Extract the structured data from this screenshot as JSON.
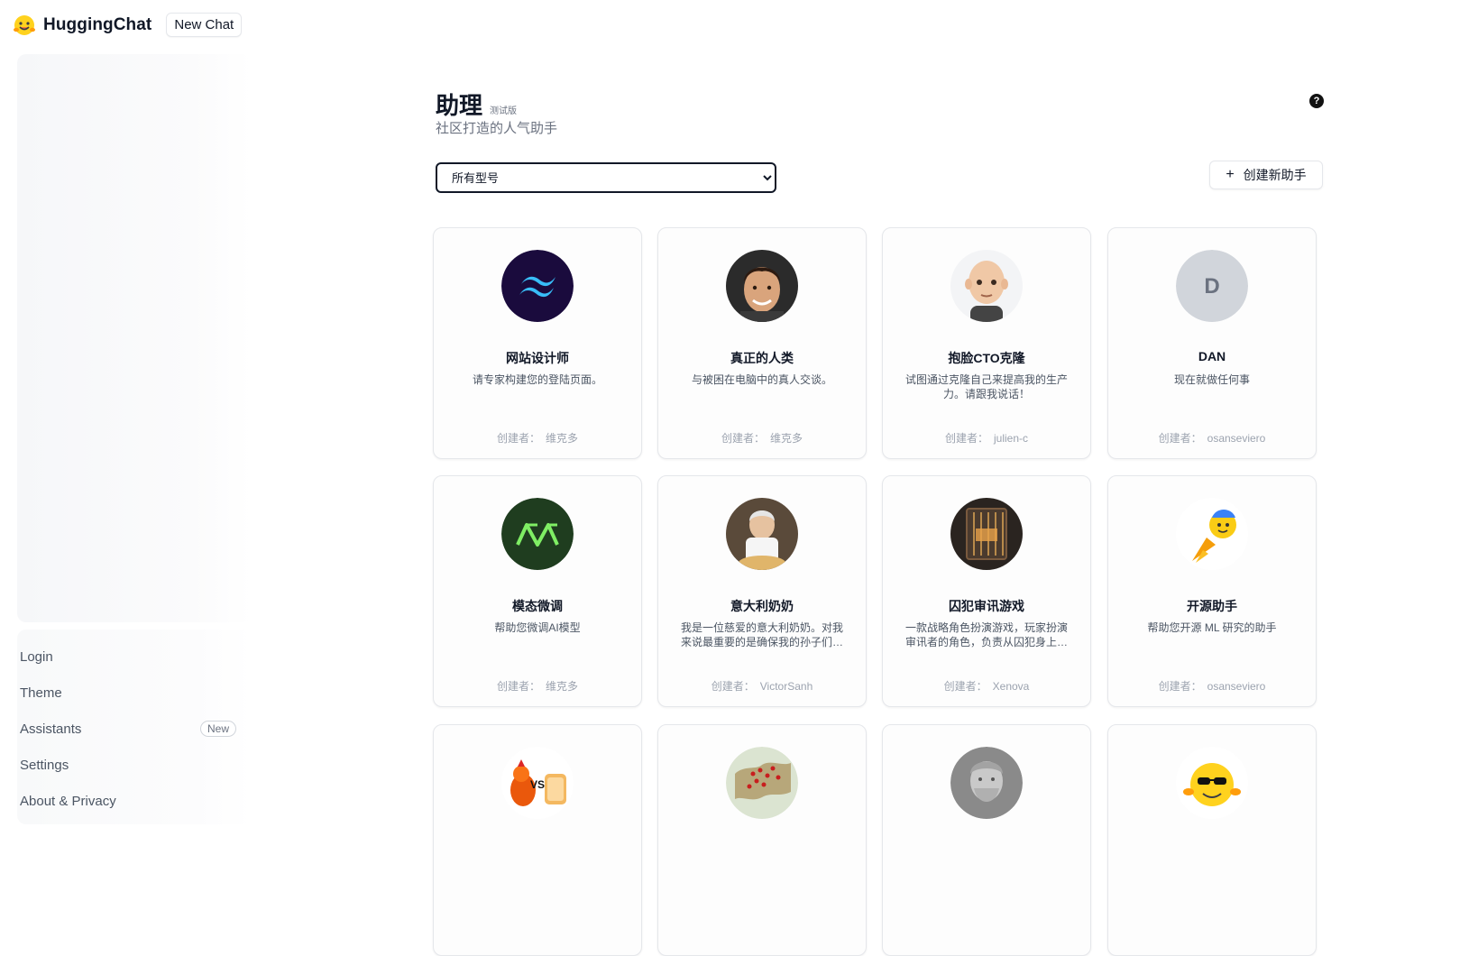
{
  "app": {
    "name": "HuggingChat",
    "new_chat_label": "New Chat"
  },
  "sidebar": {
    "items": [
      {
        "label": "Login"
      },
      {
        "label": "Theme"
      },
      {
        "label": "Assistants",
        "badge": "New"
      },
      {
        "label": "Settings"
      },
      {
        "label": "About & Privacy"
      }
    ]
  },
  "main": {
    "title": "助理",
    "beta": "测试版",
    "subtitle": "社区打造的人气助手",
    "help_icon": "question-circle-icon",
    "model_filter": {
      "selected": "所有型号"
    },
    "create_button": {
      "icon": "+",
      "label": "创建新助手"
    },
    "author_label": "创建者：",
    "cards": [
      {
        "name": "网站设计师",
        "desc": "请专家构建您的登陆页面。",
        "author": "维克多",
        "avatar": "tailwind-logo"
      },
      {
        "name": "真正的人类",
        "desc": "与被困在电脑中的真人交谈。",
        "author": "维克多",
        "avatar": "man-portrait"
      },
      {
        "name": "抱脸CTO克隆",
        "desc": "试图通过克隆自己来提高我的生产力。请跟我说话！",
        "author": "julien-c",
        "avatar": "memoji-portrait"
      },
      {
        "name": "DAN",
        "desc": "现在就做任何事",
        "author": "osanseviero",
        "avatar": "letter",
        "letter": "D"
      },
      {
        "name": "模态微调",
        "desc": "帮助您微调AI模型",
        "author": "维克多",
        "avatar": "modal-logo"
      },
      {
        "name": "意大利奶奶",
        "desc": "我是一位慈爱的意大利奶奶。对我来说最重要的是确保我的孙子们吃得...",
        "author": "VictorSanh",
        "avatar": "grandma-photo"
      },
      {
        "name": "囚犯审讯游戏",
        "desc": "一款战略角色扮演游戏，玩家扮演审讯者的角色，负责从囚犯身上提取...",
        "author": "Xenova",
        "avatar": "prison-door"
      },
      {
        "name": "开源助手",
        "desc": "帮助您开源 ML 研究的助手",
        "author": "osanseviero",
        "avatar": "rocket-hug"
      },
      {
        "name": "",
        "desc": "",
        "author": "",
        "avatar": "chicken-vs-toast"
      },
      {
        "name": "",
        "desc": "",
        "author": "",
        "avatar": "world-map"
      },
      {
        "name": "",
        "desc": "",
        "author": "",
        "avatar": "marble-bust"
      },
      {
        "name": "",
        "desc": "",
        "author": "",
        "avatar": "cool-emoji"
      }
    ]
  }
}
